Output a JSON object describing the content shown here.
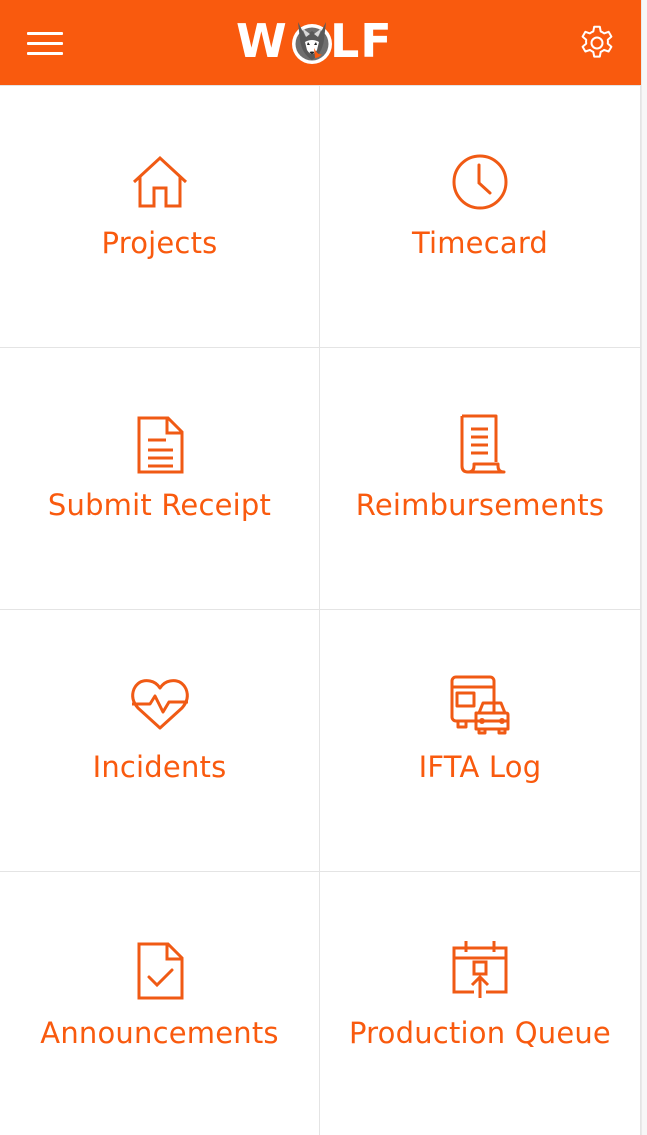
{
  "theme": {
    "accent": "#F95A0E",
    "header_bg": "#F95A0E",
    "icon_color": "#F05A14",
    "text_color": "#F05A14"
  },
  "header": {
    "brand_left": "W",
    "brand_right": "LF",
    "menu_icon": "hamburger-menu-icon",
    "logo_icon": "wolf-head-icon",
    "settings_icon": "gear-icon"
  },
  "tiles": [
    {
      "label": "Projects",
      "icon": "house-icon"
    },
    {
      "label": "Timecard",
      "icon": "clock-icon"
    },
    {
      "label": "Submit Receipt",
      "icon": "document-icon"
    },
    {
      "label": "Reimbursements",
      "icon": "scroll-receipt-icon"
    },
    {
      "label": "Incidents",
      "icon": "heart-pulse-icon"
    },
    {
      "label": "IFTA Log",
      "icon": "bus-car-icon"
    },
    {
      "label": "Announcements",
      "icon": "document-check-icon"
    },
    {
      "label": "Production Queue",
      "icon": "calendar-upload-icon"
    }
  ]
}
